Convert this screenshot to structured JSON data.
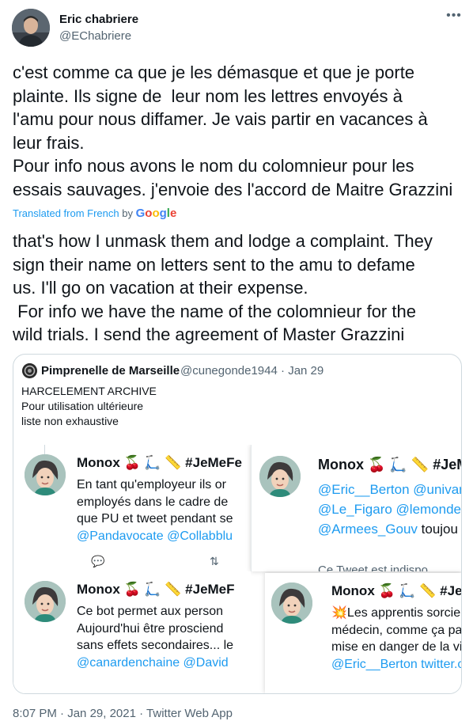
{
  "author": {
    "name": "Eric chabriere",
    "handle": "@EChabriere"
  },
  "more_icon": "more-horizontal-icon",
  "tweet": {
    "original_text": "c'est comme ca que je les démasque et que je porte\nplainte. Ils signe de  leur nom les lettres envoyés à\nl'amu pour nous diffamer. Je vais partir en vacances à\nleur frais.\nPour info nous avons le nom du colomnieur pour les\nessais sauvages. j'envoie des l'accord de Maitre Grazzini",
    "translation_label": "Translated from French",
    "translation_by": "by",
    "translation_provider": "Google",
    "translated_text": "that's how I unmask them and lodge a complaint. They\nsign their name on letters sent to the amu to defame\nus. I'll go on vacation at their expense.\n For info we have the name of the colomnieur for the\nwild trials. I send the agreement of Master Grazzini"
  },
  "quoted": {
    "name": "Pimprenelle de Marseille",
    "handle": "@cunegonde1944",
    "separator": "·",
    "date": "Jan 29",
    "text": "HARCELEMENT ARCHIVE\nPour utilisation ultérieure\nliste non exhaustive",
    "cards": [
      {
        "name": "Monox 🍒 🛴 📏 #JeMeFe",
        "lines": [
          "En tant qu'employeur ils or",
          "employés dans le cadre de",
          "que PU et tweet pendant se"
        ],
        "links": "@Pandavocate @Collabblu",
        "actions": [
          "💬",
          "⇅"
        ]
      },
      {
        "name": "Monox 🍒 🛴 📏 #JeM",
        "links_lines": [
          "@Eric__Berton @univar",
          "@Le_Figaro @lemonde"
        ],
        "mixed_link": "@Armees_Gouv",
        "mixed_tail": " toujou",
        "cutoff": "Ce Tweet est indispo"
      },
      {
        "name": "Monox 🍒 🛴 📏 #JeMeF",
        "lines": [
          "Ce bot permet aux person",
          "Aujourd'hui être prosciend",
          "sans effets secondaires... le"
        ],
        "links": "@canardenchaine @David"
      },
      {
        "name": "Monox 🍒 🛴 📏 #JeM",
        "emoji": "💥",
        "lines": [
          "Les apprentis sorcier",
          "médecin, comme ça pa",
          "mise en danger de la vi"
        ],
        "links": "@Eric__Berton twitter.c"
      }
    ]
  },
  "footer": {
    "time": "8:07 PM",
    "date": "Jan 29, 2021",
    "source": "Twitter Web App",
    "separator": "·"
  },
  "colors": {
    "link": "#1d9bf0",
    "secondary": "#536471",
    "border": "#cfd9de"
  }
}
